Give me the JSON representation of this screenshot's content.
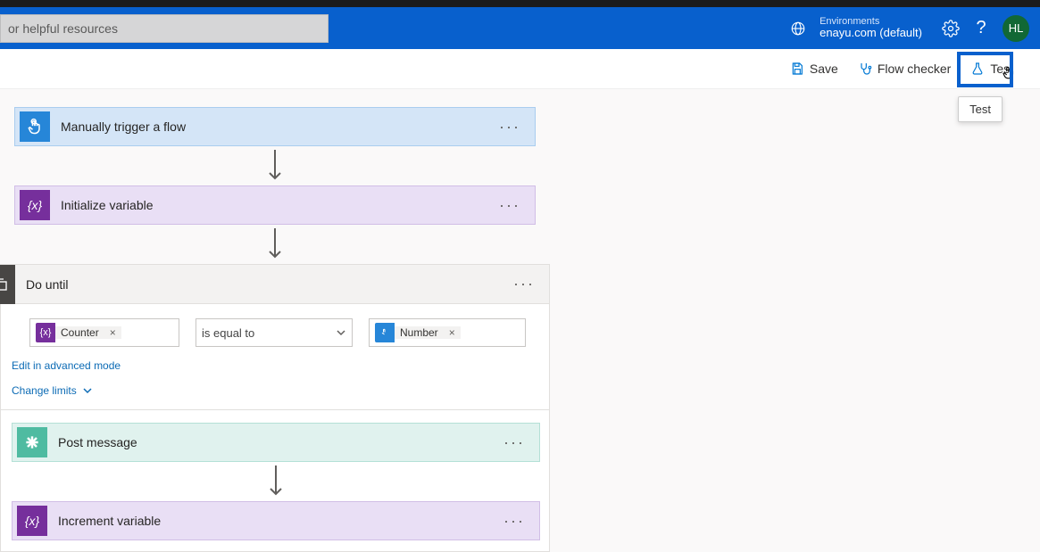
{
  "header": {
    "search_placeholder": "or helpful resources",
    "environments_label": "Environments",
    "environment_name": "enayu.com (default)",
    "avatar_initials": "HL"
  },
  "commands": {
    "save": "Save",
    "flow_checker": "Flow checker",
    "test": "Test",
    "test_tooltip": "Test"
  },
  "flow": {
    "trigger_title": "Manually trigger a flow",
    "init_var_title": "Initialize variable",
    "do_until_title": "Do until",
    "post_message_title": "Post message",
    "increment_var_title": "Increment variable"
  },
  "do_until": {
    "left_token": "Counter",
    "operator": "is equal to",
    "right_token": "Number",
    "edit_advanced": "Edit in advanced mode",
    "change_limits": "Change limits"
  }
}
